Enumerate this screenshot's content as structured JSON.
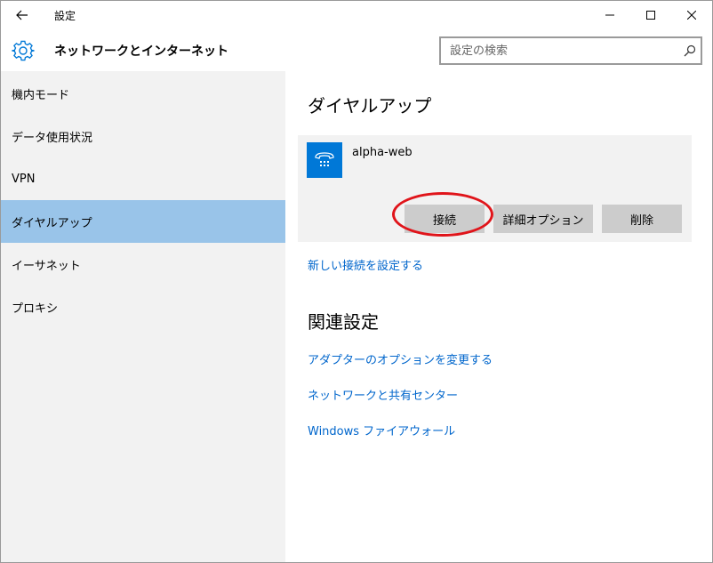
{
  "window": {
    "title": "設定",
    "header_title": "ネットワークとインターネット"
  },
  "search": {
    "placeholder": "設定の検索"
  },
  "sidebar": {
    "items": [
      {
        "label": "機内モード",
        "active": false
      },
      {
        "label": "データ使用状況",
        "active": false
      },
      {
        "label": "VPN",
        "active": false
      },
      {
        "label": "ダイヤルアップ",
        "active": true
      },
      {
        "label": "イーサネット",
        "active": false
      },
      {
        "label": "プロキシ",
        "active": false
      }
    ]
  },
  "main": {
    "section_title": "ダイヤルアップ",
    "connection": {
      "name": "alpha-web",
      "icon": "dialup-phone-icon",
      "buttons": {
        "connect": "接続",
        "advanced": "詳細オプション",
        "delete": "削除"
      }
    },
    "new_connection_link": "新しい接続を設定する",
    "related_title": "関連設定",
    "related_links": [
      "アダプターのオプションを変更する",
      "ネットワークと共有センター",
      "Windows ファイアウォール"
    ]
  },
  "colors": {
    "accent": "#0078d7",
    "active_item": "#99c4e9",
    "link": "#0066cc",
    "highlight": "#e0141a",
    "sidebar_bg": "#f2f2f2",
    "button_bg": "#cccccc"
  }
}
